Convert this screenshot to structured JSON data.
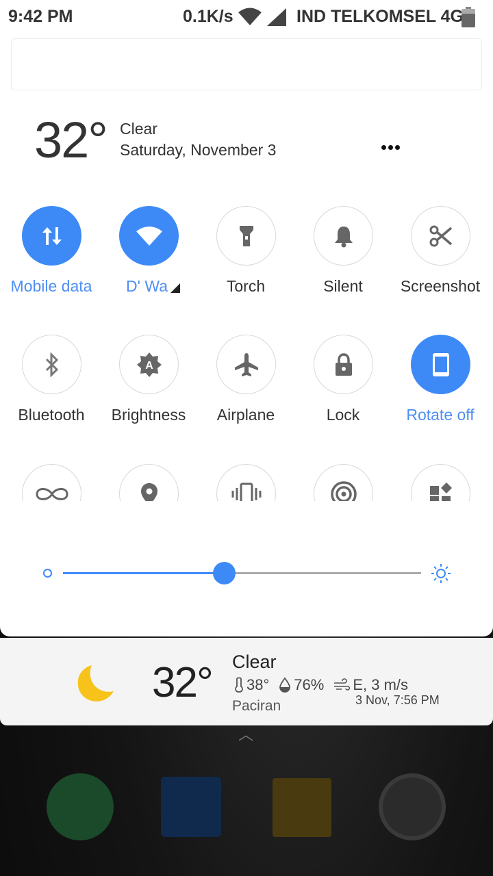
{
  "status_bar": {
    "time": "9:42 PM",
    "net_speed": "0.1K/s",
    "carrier": "IND TELKOMSEL 4G",
    "icons": [
      "wifi-icon",
      "cell-signal-icon",
      "battery-icon"
    ]
  },
  "weather_header": {
    "temperature": "32°",
    "condition": "Clear",
    "date": "Saturday, November 3"
  },
  "quick_toggles": [
    {
      "label": "Mobile data",
      "icon": "mobile-data-icon",
      "active": true
    },
    {
      "label": "D' Wa",
      "icon": "wifi-icon",
      "active": true
    },
    {
      "label": "Torch",
      "icon": "torch-icon",
      "active": false
    },
    {
      "label": "Silent",
      "icon": "bell-icon",
      "active": false
    },
    {
      "label": "Screenshot",
      "icon": "scissors-icon",
      "active": false
    },
    {
      "label": "Bluetooth",
      "icon": "bluetooth-icon",
      "active": false
    },
    {
      "label": "Brightness",
      "icon": "auto-brightness-icon",
      "active": false
    },
    {
      "label": "Airplane",
      "icon": "airplane-icon",
      "active": false
    },
    {
      "label": "Lock",
      "icon": "lock-icon",
      "active": false
    },
    {
      "label": "Rotate off",
      "icon": "rotate-lock-icon",
      "active": true
    }
  ],
  "partial_toggles": [
    "infinity-icon",
    "location-icon",
    "vibrate-icon",
    "hotspot-icon",
    "widgets-icon"
  ],
  "brightness": {
    "level": 0.45
  },
  "weather_card": {
    "temperature": "32°",
    "condition": "Clear",
    "feels_like": "38°",
    "humidity": "76%",
    "wind": "E, 3 m/s",
    "location": "Paciran",
    "updated": "3 Nov, 7:56 PM"
  },
  "colors": {
    "accent": "#3d8af7",
    "accent_text": "#4e8ef4",
    "moon": "#f7c21a"
  }
}
